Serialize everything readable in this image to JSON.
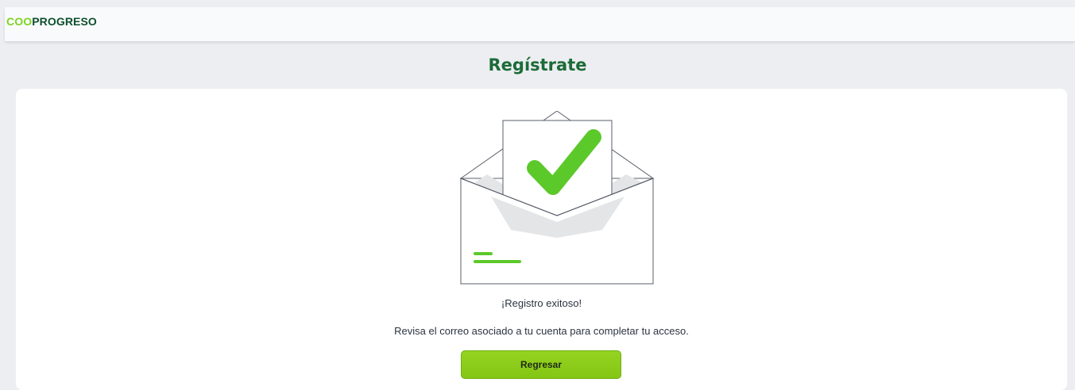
{
  "header": {
    "logo_prefix": "COO",
    "logo_suffix": "PROGRESO"
  },
  "page": {
    "title": "Regístrate"
  },
  "result": {
    "heading": "¡Registro exitoso!",
    "message": "Revisa el correo asociado a tu cuenta para completar tu acceso.",
    "back_label": "Regresar"
  },
  "illustration": {
    "icon": "envelope-checkmark-icon"
  },
  "colors": {
    "brand_green": "#7ed321",
    "brand_dark": "#0d4f2e",
    "title_green": "#1c6b38",
    "check_green": "#5cc92a",
    "button_green": "#8ccd1a"
  }
}
